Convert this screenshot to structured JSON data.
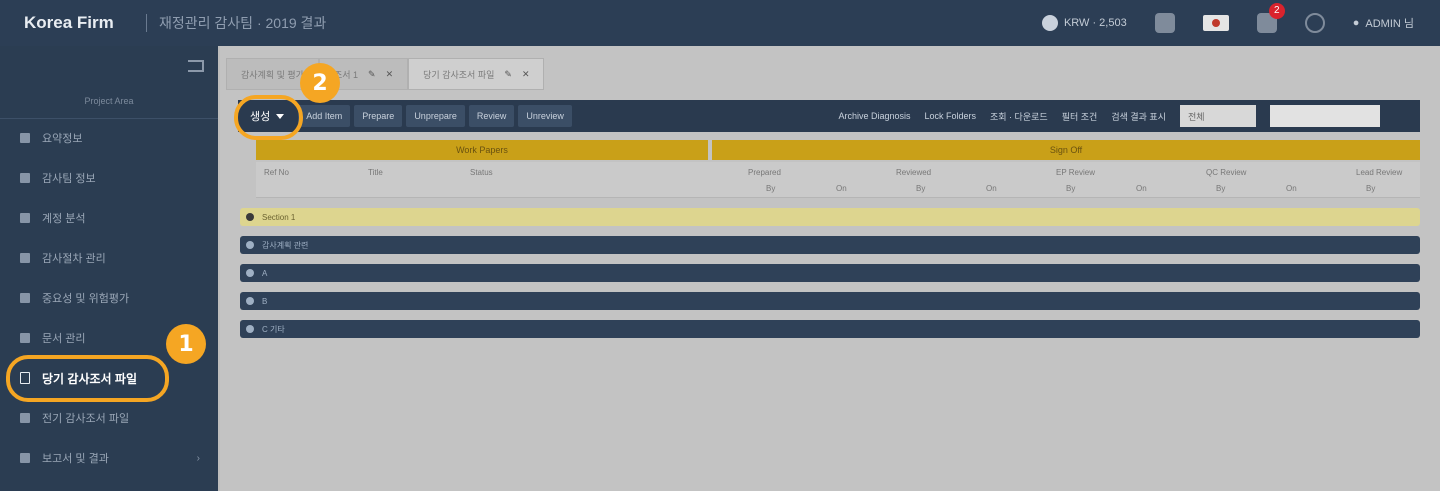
{
  "header": {
    "brand": "Korea Firm",
    "breadcrumb": "재정관리 감사팀 · 2019 결과",
    "language": "KRW · 2,503",
    "notification_count": "2",
    "user_label": "ADMIN 님"
  },
  "sidebar": {
    "project_label": "Project Area",
    "items": [
      {
        "label": "요약정보",
        "icon": "dashboard-icon"
      },
      {
        "label": "감사팀 정보",
        "icon": "team-icon"
      },
      {
        "label": "계정 분석",
        "icon": "chart-icon"
      },
      {
        "label": "감사절차 관리",
        "icon": "list-icon"
      },
      {
        "label": "중요성 및 위험평가",
        "icon": "shield-icon"
      },
      {
        "label": "문서 관리",
        "icon": "folder-icon"
      },
      {
        "label": "당기 감사조서 파일",
        "icon": "document-icon",
        "active": true
      },
      {
        "label": "전기 감사조서 파일",
        "icon": "archive-icon"
      },
      {
        "label": "보고서 및 결과",
        "icon": "report-icon"
      }
    ]
  },
  "tabs": [
    {
      "label": "감사계획 및 평가"
    },
    {
      "label": "조서 1"
    },
    {
      "label": "당기 감사조서 파일"
    }
  ],
  "toolbar": {
    "create_label": "생성",
    "buttons": [
      "Add Item",
      "Prepare",
      "Unprepare",
      "Review",
      "Unreview"
    ],
    "right_items": [
      "Archive Diagnosis",
      "Lock Folders",
      "조회 · 다운로드",
      "필터 조건",
      "검색 결과 표시"
    ],
    "select_value": "전체"
  },
  "grid": {
    "group_headers": [
      "Work Papers",
      "Sign Off"
    ],
    "columns": [
      "Ref No",
      "Title",
      "Status",
      "Prepared",
      "Reviewed",
      "EP Review",
      "QC Review",
      "Lead Review"
    ],
    "sub_columns": [
      "By",
      "On"
    ]
  },
  "sections": [
    {
      "label": "Section 1",
      "style": "yellow"
    },
    {
      "label": "감사계획 관련",
      "style": "dark"
    },
    {
      "label": "A",
      "style": "dark"
    },
    {
      "label": "B",
      "style": "dark"
    },
    {
      "label": "C 기타",
      "style": "dark"
    }
  ],
  "callouts": [
    "1",
    "2"
  ],
  "colors": {
    "topbar": "#2c3e55",
    "sidebar": "#2b3d52",
    "accent": "#f5a623",
    "section_yellow": "#ddd58f",
    "header_gold": "#c9a018"
  }
}
